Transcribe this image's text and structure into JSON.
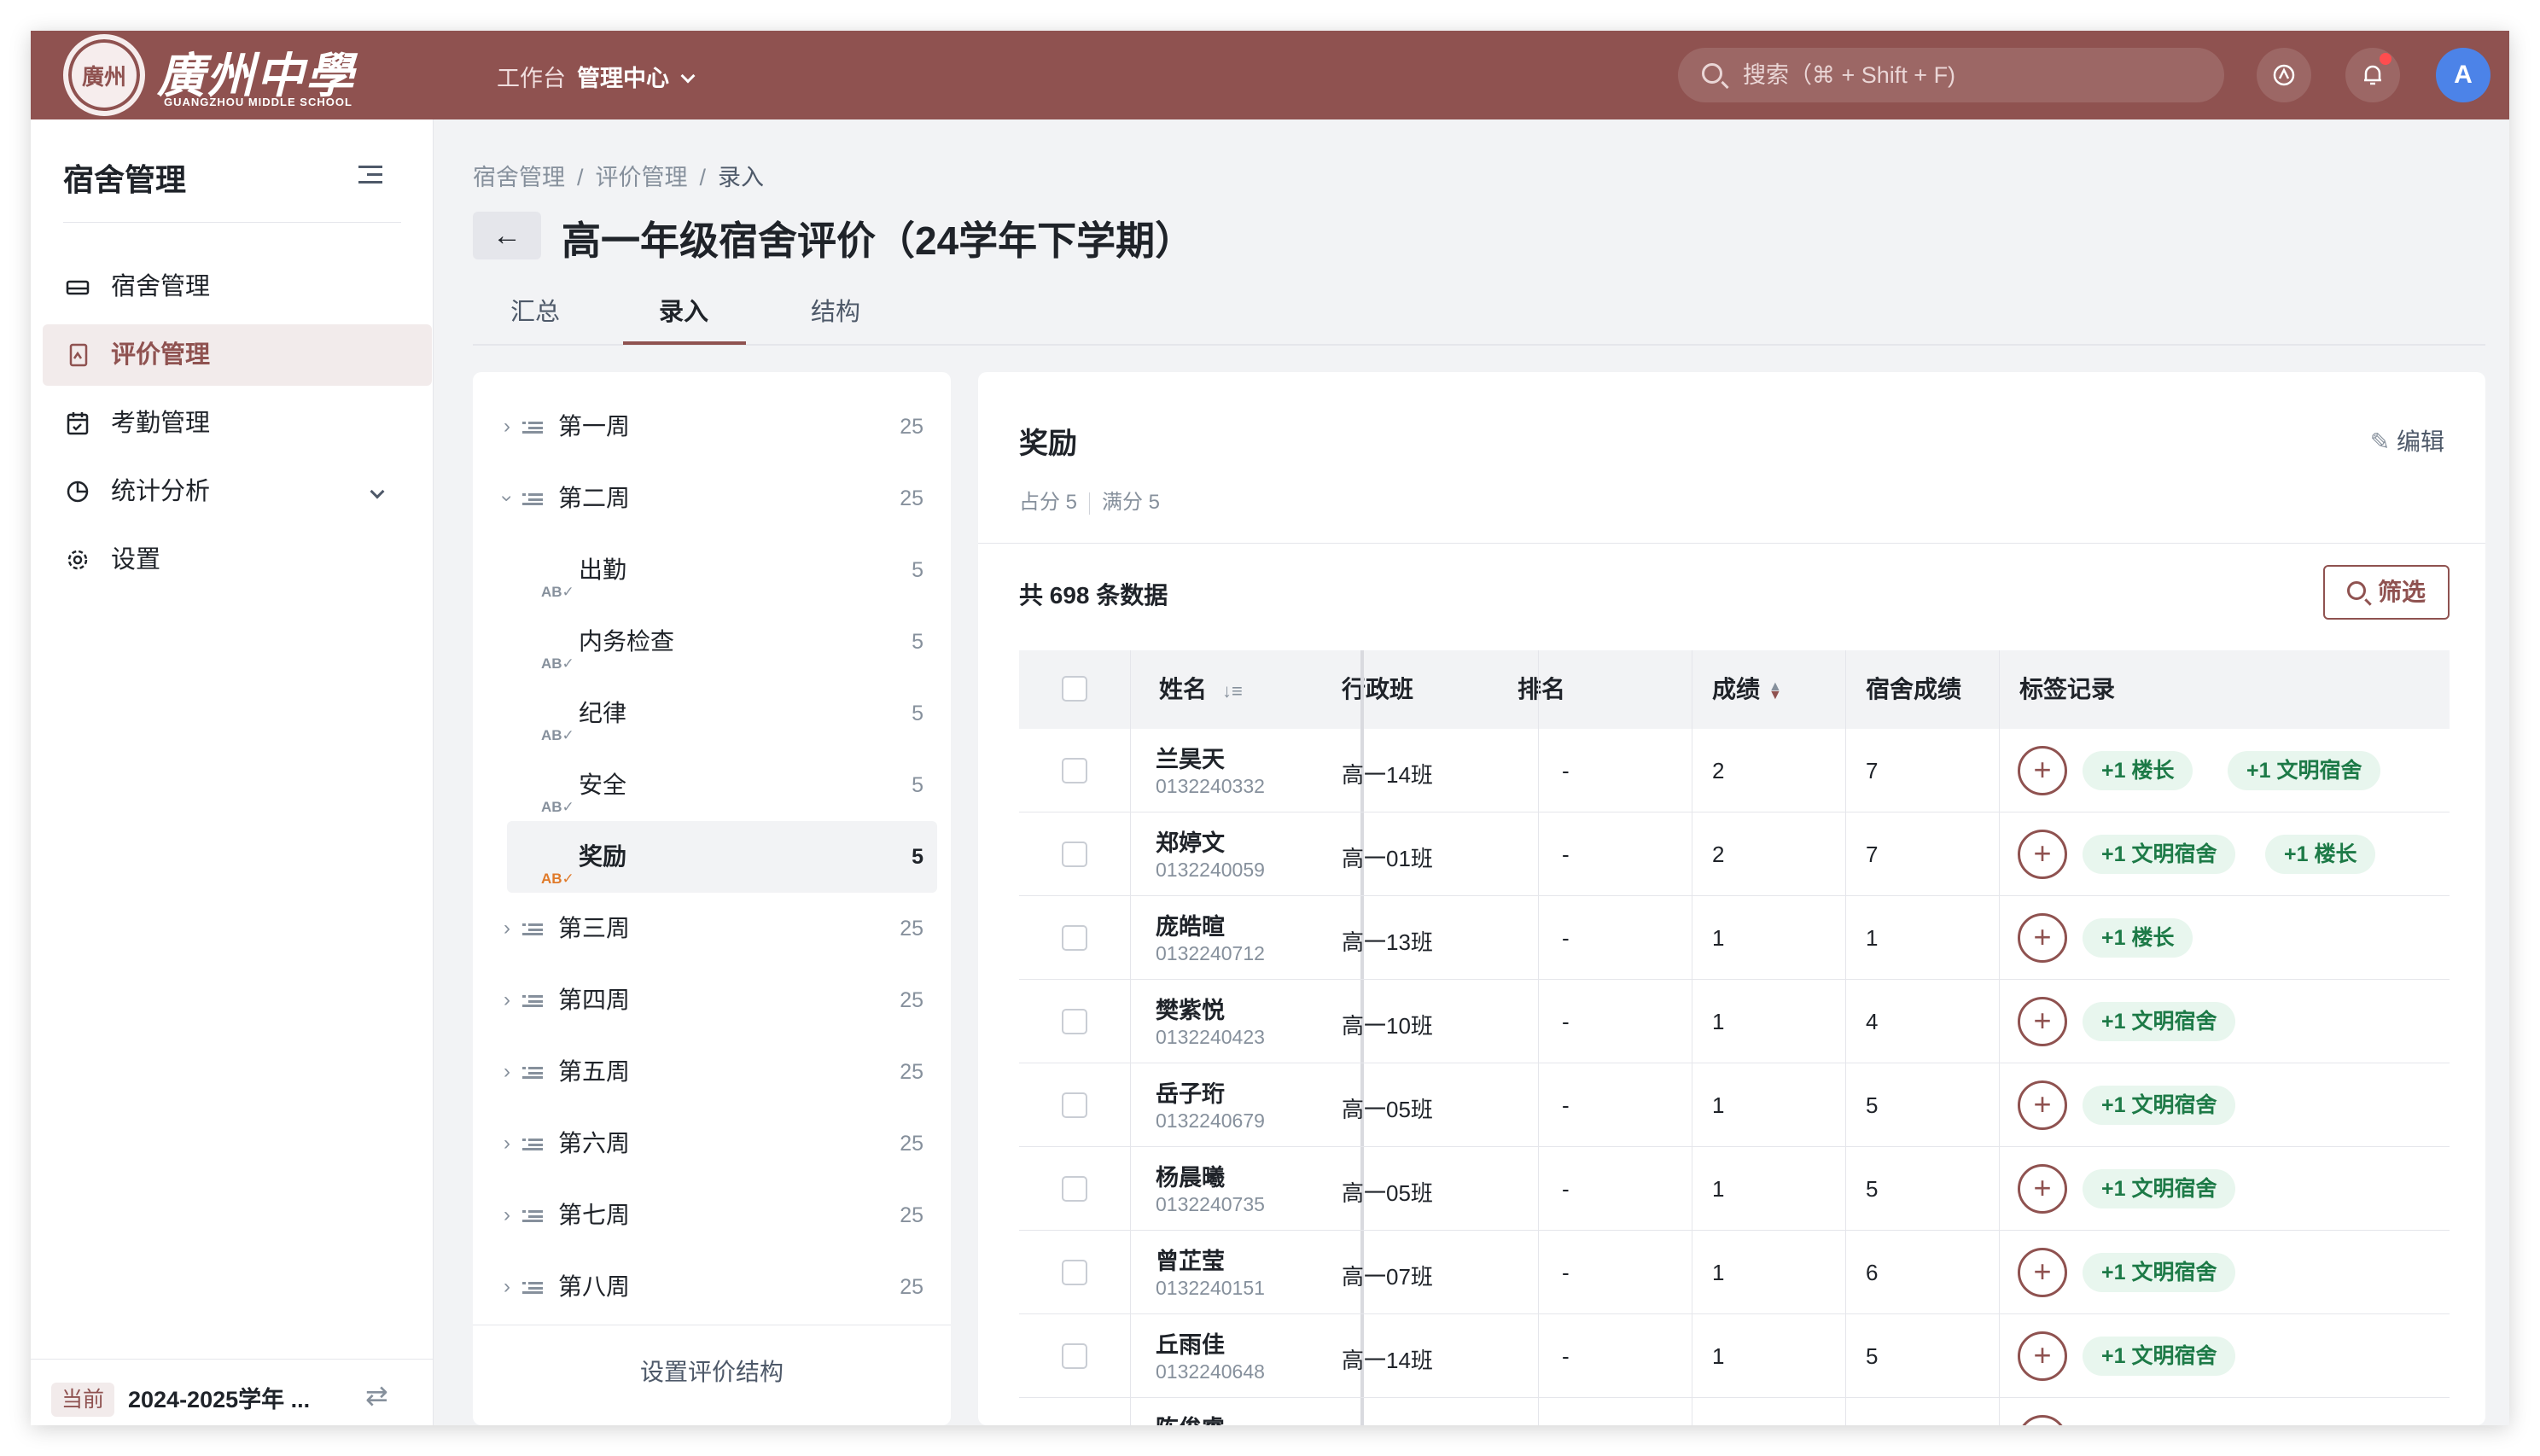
{
  "logo": {
    "emblem": "廣州",
    "name": "廣州中學",
    "subtitle": "GUANGZHOU MIDDLE SCHOOL"
  },
  "topnav": {
    "workbench": "工作台",
    "admin_center": "管理中心"
  },
  "search": {
    "placeholder": "搜索（⌘ + Shift + F)"
  },
  "user": {
    "avatar_letter": "A"
  },
  "sidebar": {
    "title": "宿舍管理",
    "items": [
      {
        "label": "宿舍管理",
        "icon": "bed-icon"
      },
      {
        "label": "评价管理",
        "icon": "document-icon",
        "active": true
      },
      {
        "label": "考勤管理",
        "icon": "calendar-icon"
      },
      {
        "label": "统计分析",
        "icon": "pie-chart-icon"
      },
      {
        "label": "设置",
        "icon": "gear-icon"
      }
    ],
    "term_tag": "当前",
    "term_value": "2024-2025学年 ..."
  },
  "breadcrumb": [
    "宿舍管理",
    "评价管理",
    "录入"
  ],
  "page": {
    "title": "高一年级宿舍评价（24学年下学期）"
  },
  "tabs": [
    "汇总",
    "录入",
    "结构"
  ],
  "tree": {
    "rows": [
      {
        "label": "第一周",
        "count": "25"
      },
      {
        "label": "第二周",
        "count": "25"
      },
      {
        "label": "出勤",
        "count": "5"
      },
      {
        "label": "内务检查",
        "count": "5"
      },
      {
        "label": "纪律",
        "count": "5"
      },
      {
        "label": "安全",
        "count": "5"
      },
      {
        "label": "奖励",
        "count": "5"
      },
      {
        "label": "第三周",
        "count": "25"
      },
      {
        "label": "第四周",
        "count": "25"
      },
      {
        "label": "第五周",
        "count": "25"
      },
      {
        "label": "第六周",
        "count": "25"
      },
      {
        "label": "第七周",
        "count": "25"
      },
      {
        "label": "第八周",
        "count": "25"
      }
    ],
    "footer": "设置评价结构"
  },
  "section": {
    "title": "奖励",
    "share": "占分 5",
    "full": "满分 5",
    "edit": "编辑",
    "total": "共 698 条数据",
    "filter": "筛选"
  },
  "table": {
    "headers": {
      "name": "姓名",
      "class": "行政班",
      "rank": "排名",
      "score": "成绩",
      "dorm_score": "宿舍成绩",
      "tags": "标签记录"
    },
    "rows": [
      {
        "name": "兰昊天",
        "id": "0132240332",
        "class": "高一14班",
        "rank": "-",
        "score": "2",
        "dorm": "7",
        "tags": [
          "+1 楼长",
          "+1 文明宿舍"
        ]
      },
      {
        "name": "郑婷文",
        "id": "0132240059",
        "class": "高一01班",
        "rank": "-",
        "score": "2",
        "dorm": "7",
        "tags": [
          "+1 文明宿舍",
          "+1 楼长"
        ]
      },
      {
        "name": "庞皓暄",
        "id": "0132240712",
        "class": "高一13班",
        "rank": "-",
        "score": "1",
        "dorm": "1",
        "tags": [
          "+1 楼长"
        ]
      },
      {
        "name": "樊紫悦",
        "id": "0132240423",
        "class": "高一10班",
        "rank": "-",
        "score": "1",
        "dorm": "4",
        "tags": [
          "+1 文明宿舍"
        ]
      },
      {
        "name": "岳子珩",
        "id": "0132240679",
        "class": "高一05班",
        "rank": "-",
        "score": "1",
        "dorm": "5",
        "tags": [
          "+1 文明宿舍"
        ]
      },
      {
        "name": "杨晨曦",
        "id": "0132240735",
        "class": "高一05班",
        "rank": "-",
        "score": "1",
        "dorm": "5",
        "tags": [
          "+1 文明宿舍"
        ]
      },
      {
        "name": "曾芷莹",
        "id": "0132240151",
        "class": "高一07班",
        "rank": "-",
        "score": "1",
        "dorm": "6",
        "tags": [
          "+1 文明宿舍"
        ]
      },
      {
        "name": "丘雨佳",
        "id": "0132240648",
        "class": "高一14班",
        "rank": "-",
        "score": "1",
        "dorm": "5",
        "tags": [
          "+1 文明宿舍"
        ]
      },
      {
        "name": "陈俊睿",
        "id": "",
        "class": "",
        "rank": "",
        "score": "",
        "dorm": "",
        "tags": []
      }
    ]
  },
  "colors": {
    "brand": "#8f5250",
    "tag_bg": "#e8f6ee",
    "tag_text": "#1d7a47"
  }
}
